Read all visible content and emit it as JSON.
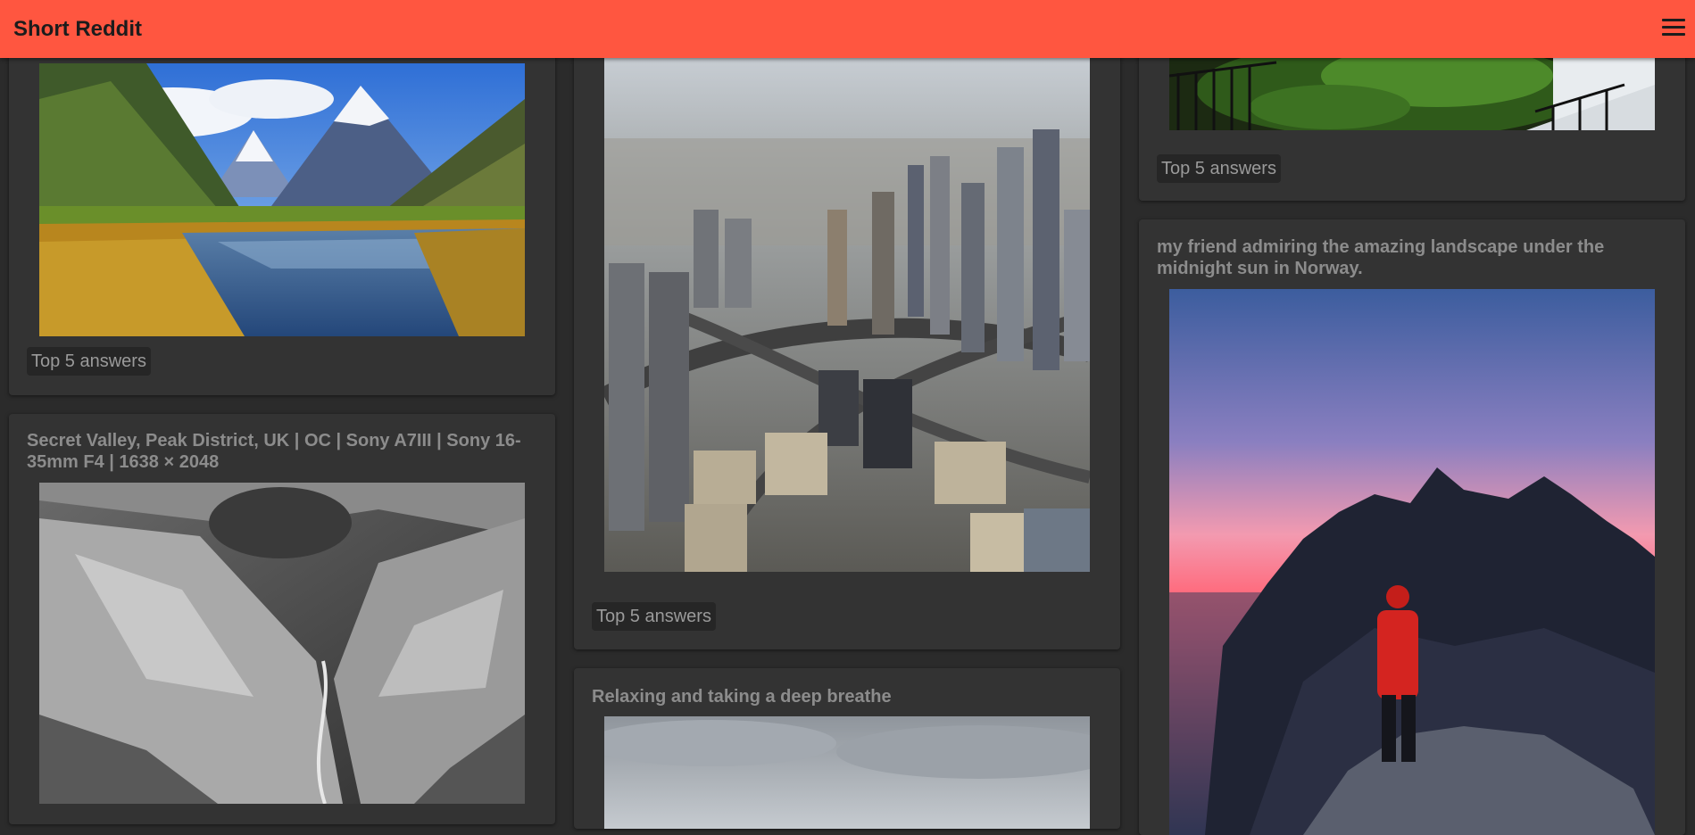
{
  "app": {
    "title": "Short Reddit",
    "menu_icon": "hamburger-menu-icon",
    "accent_color": "#ff5640",
    "background_color": "#2b2b2b",
    "card_color": "#333333"
  },
  "posts": [
    {
      "title": "",
      "image": "mountain-valley-river-photo",
      "answers_label": "Top 5 answers"
    },
    {
      "title": "Secret Valley, Peak District, UK | OC | Sony A7III | Sony 16-35mm F4 | 1638 × 2048",
      "image": "black-and-white-valley-photo"
    },
    {
      "title": "",
      "image": "city-skyline-aerial-photo",
      "answers_label": "Top 5 answers"
    },
    {
      "title": "Relaxing and taking a deep breathe",
      "image": "cloudy-sky-photo"
    },
    {
      "title": "",
      "image": "balcony-greenery-photo",
      "answers_label": "Top 5 answers"
    },
    {
      "title": "my friend admiring the amazing landscape under the midnight sun in Norway.",
      "image": "norway-midnight-sun-hiker-photo"
    }
  ]
}
